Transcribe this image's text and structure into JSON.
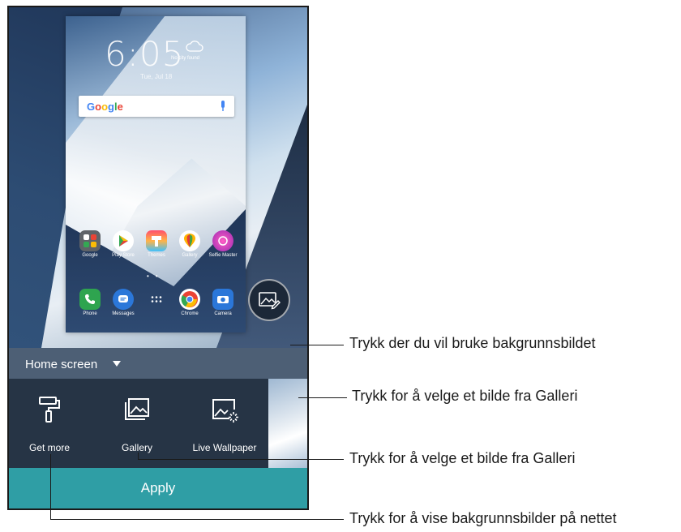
{
  "lockscreen": {
    "time": "6:05",
    "date": "Tue, Jul 18",
    "weather": "No city found"
  },
  "search": {
    "brand": "Google"
  },
  "apps_row1": [
    {
      "label": "Google",
      "color": "#5f6368"
    },
    {
      "label": "Play Store",
      "color": "#ffffff"
    },
    {
      "label": "Themes",
      "color": "#ff5a5f"
    },
    {
      "label": "Gallery",
      "color": "#ffffff"
    },
    {
      "label": "Selfie Master",
      "color": "#d63fbf"
    }
  ],
  "apps_row2": [
    {
      "label": "Phone",
      "color": "#2ea44f"
    },
    {
      "label": "Messages",
      "color": "#2b77d9"
    },
    {
      "label": "",
      "color": "transparent"
    },
    {
      "label": "Chrome",
      "color": "#ffffff"
    },
    {
      "label": "Camera",
      "color": "#2b77d9"
    }
  ],
  "dropdown": {
    "label": "Home screen"
  },
  "options": [
    {
      "label": "Get more",
      "icon": "paint-roller-icon"
    },
    {
      "label": "Gallery",
      "icon": "gallery-icon"
    },
    {
      "label": "Live Wallpaper",
      "icon": "live-wallpaper-icon"
    }
  ],
  "apply_label": "Apply",
  "callouts": [
    "Trykk der du vil bruke bakgrunnsbildet",
    "Trykk for å velge et bilde fra Galleri",
    "Trykk for å velge et bilde fra Galleri",
    "Trykk for å vise bakgrunnsbilder på nettet"
  ],
  "colors": {
    "apply": "#2f9ea5",
    "bar": "#4d5f75",
    "strip": "#263445"
  }
}
